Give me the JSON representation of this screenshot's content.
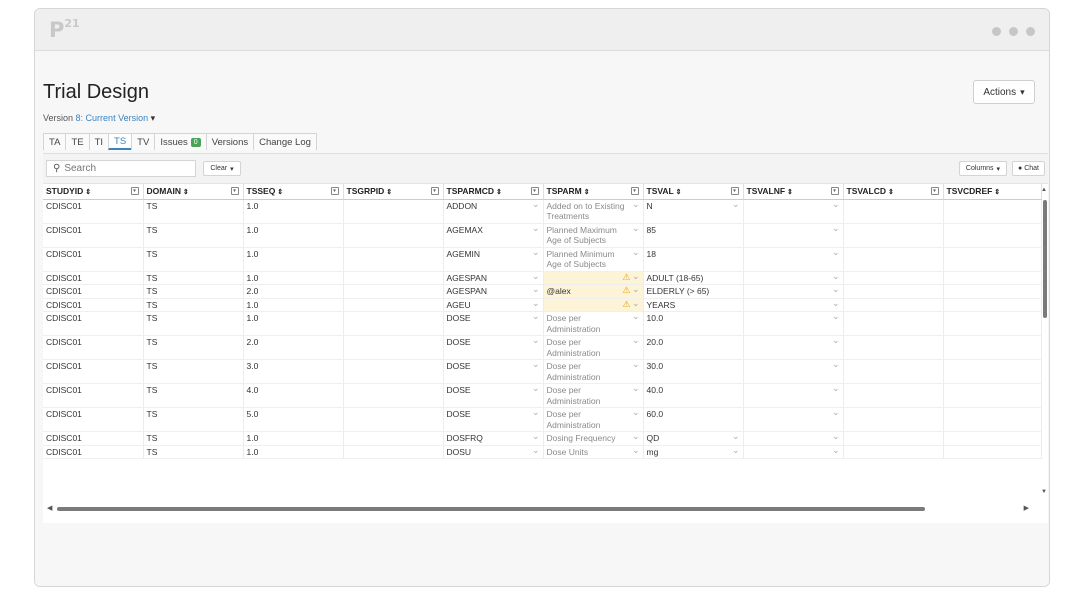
{
  "app": {
    "logo": "P",
    "logo_sup": "21"
  },
  "page": {
    "title": "Trial Design",
    "actions_label": "Actions"
  },
  "version": {
    "label": "Version",
    "value": "8: Current Version"
  },
  "tabs": [
    {
      "label": "TA"
    },
    {
      "label": "TE"
    },
    {
      "label": "TI"
    },
    {
      "label": "TS"
    },
    {
      "label": "TV"
    },
    {
      "label": "Issues",
      "badge": "0"
    },
    {
      "label": "Versions"
    },
    {
      "label": "Change Log"
    }
  ],
  "active_tab": "TS",
  "toolbar": {
    "search_placeholder": "Search",
    "clear_label": "Clear",
    "columns_label": "Columns",
    "chat_label": "Chat"
  },
  "columns": [
    "STUDYID",
    "DOMAIN",
    "TSSEQ",
    "TSGRPID",
    "TSPARMCD",
    "TSPARM",
    "TSVAL",
    "TSVALNF",
    "TSVALCD",
    "TSVCDREF"
  ],
  "rows": [
    {
      "studyid": "CDISC01",
      "domain": "TS",
      "tsseq": "1.0",
      "tsgrpid": "",
      "tsparmcd": "ADDON",
      "tsparm": "Added on to Existing Treatments",
      "tsval": "N",
      "tsvalnf": "",
      "tsvalcd": "",
      "tsvcdref": ""
    },
    {
      "studyid": "CDISC01",
      "domain": "TS",
      "tsseq": "1.0",
      "tsgrpid": "",
      "tsparmcd": "AGEMAX",
      "tsparm": "Planned Maximum Age of Subjects",
      "tsval": "85",
      "tsvalnf": "",
      "tsvalcd": "",
      "tsvcdref": ""
    },
    {
      "studyid": "CDISC01",
      "domain": "TS",
      "tsseq": "1.0",
      "tsgrpid": "",
      "tsparmcd": "AGEMIN",
      "tsparm": "Planned Minimum Age of Subjects",
      "tsval": "18",
      "tsvalnf": "",
      "tsvalcd": "",
      "tsvcdref": ""
    },
    {
      "studyid": "CDISC01",
      "domain": "TS",
      "tsseq": "1.0",
      "tsgrpid": "",
      "tsparmcd": "AGESPAN",
      "tsparm": "",
      "tsval": "ADULT (18-65)",
      "tsvalnf": "",
      "tsvalcd": "",
      "tsvcdref": ""
    },
    {
      "studyid": "CDISC01",
      "domain": "TS",
      "tsseq": "2.0",
      "tsgrpid": "",
      "tsparmcd": "AGESPAN",
      "tsparm": "@alex",
      "tsval": "ELDERLY (> 65)",
      "tsvalnf": "",
      "tsvalcd": "",
      "tsvcdref": ""
    },
    {
      "studyid": "CDISC01",
      "domain": "TS",
      "tsseq": "1.0",
      "tsgrpid": "",
      "tsparmcd": "AGEU",
      "tsparm": "",
      "tsval": "YEARS",
      "tsvalnf": "",
      "tsvalcd": "",
      "tsvcdref": ""
    },
    {
      "studyid": "CDISC01",
      "domain": "TS",
      "tsseq": "1.0",
      "tsgrpid": "",
      "tsparmcd": "DOSE",
      "tsparm": "Dose per Administration",
      "tsval": "10.0",
      "tsvalnf": "",
      "tsvalcd": "",
      "tsvcdref": ""
    },
    {
      "studyid": "CDISC01",
      "domain": "TS",
      "tsseq": "2.0",
      "tsgrpid": "",
      "tsparmcd": "DOSE",
      "tsparm": "Dose per Administration",
      "tsval": "20.0",
      "tsvalnf": "",
      "tsvalcd": "",
      "tsvcdref": ""
    },
    {
      "studyid": "CDISC01",
      "domain": "TS",
      "tsseq": "3.0",
      "tsgrpid": "",
      "tsparmcd": "DOSE",
      "tsparm": "Dose per Administration",
      "tsval": "30.0",
      "tsvalnf": "",
      "tsvalcd": "",
      "tsvcdref": ""
    },
    {
      "studyid": "CDISC01",
      "domain": "TS",
      "tsseq": "4.0",
      "tsgrpid": "",
      "tsparmcd": "DOSE",
      "tsparm": "Dose per Administration",
      "tsval": "40.0",
      "tsvalnf": "",
      "tsvalcd": "",
      "tsvcdref": ""
    },
    {
      "studyid": "CDISC01",
      "domain": "TS",
      "tsseq": "5.0",
      "tsgrpid": "",
      "tsparmcd": "DOSE",
      "tsparm": "Dose per Administration",
      "tsval": "60.0",
      "tsvalnf": "",
      "tsvalcd": "",
      "tsvcdref": ""
    },
    {
      "studyid": "CDISC01",
      "domain": "TS",
      "tsseq": "1.0",
      "tsgrpid": "",
      "tsparmcd": "DOSFRQ",
      "tsparm": "Dosing Frequency",
      "tsval": "QD",
      "tsvalnf": "",
      "tsvalcd": "",
      "tsvcdref": ""
    },
    {
      "studyid": "CDISC01",
      "domain": "TS",
      "tsseq": "1.0",
      "tsgrpid": "",
      "tsparmcd": "DOSU",
      "tsparm": "Dose Units",
      "tsval": "mg",
      "tsvalnf": "",
      "tsvalcd": "",
      "tsvcdref": ""
    }
  ],
  "warning_rows": [
    3,
    4,
    5
  ],
  "tsval_dropdown_rows": [
    0,
    11,
    12
  ],
  "colors": {
    "accent": "#3a84c2",
    "warn_bg": "#fdf3d7",
    "warn_icon": "#e3a21a",
    "badge": "#49a35a"
  }
}
